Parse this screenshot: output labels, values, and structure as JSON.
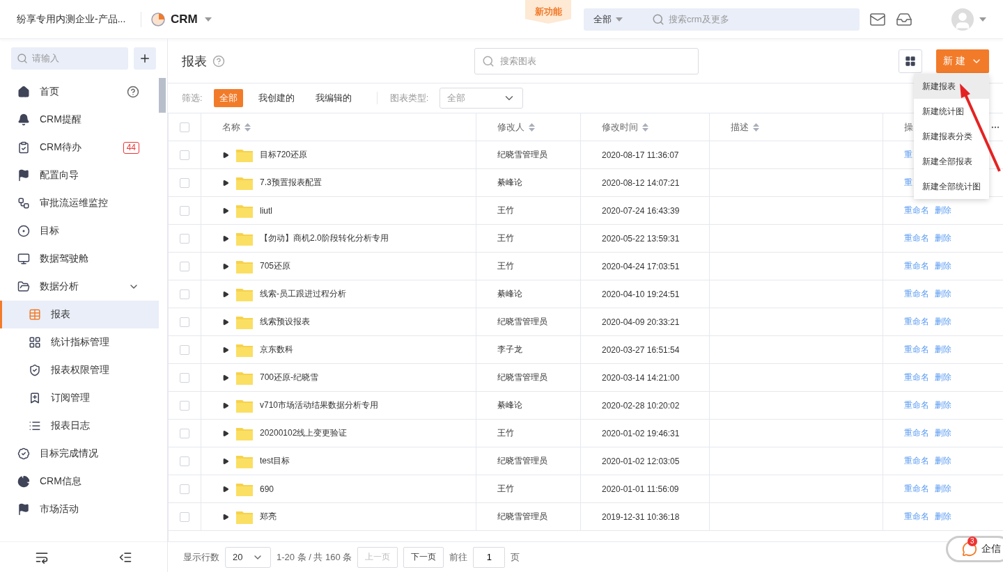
{
  "header": {
    "org": "纷享专用内测企业-产品...",
    "app": "CRM",
    "new_feature": "新功能",
    "search_scope": "全部",
    "search_placeholder": "搜索crm及更多"
  },
  "sidebar": {
    "search_placeholder": "请输入",
    "items": [
      {
        "kind": "home",
        "label": "首页",
        "help": true
      },
      {
        "kind": "bell",
        "label": "CRM提醒"
      },
      {
        "kind": "clipboard",
        "label": "CRM待办",
        "badge": "44"
      },
      {
        "kind": "flag",
        "label": "配置向导"
      },
      {
        "kind": "flow",
        "label": "审批流运维监控"
      },
      {
        "kind": "target",
        "label": "目标"
      },
      {
        "kind": "monitor",
        "label": "数据驾驶舱"
      },
      {
        "kind": "folder",
        "label": "数据分析",
        "expanded": true,
        "children": [
          {
            "kind": "table",
            "label": "报表",
            "selected": true
          },
          {
            "kind": "grid",
            "label": "统计指标管理",
            "selected": false
          },
          {
            "kind": "shield",
            "label": "报表权限管理",
            "selected": false
          },
          {
            "kind": "bookmark",
            "label": "订阅管理",
            "selected": false
          },
          {
            "kind": "list",
            "label": "报表日志",
            "selected": false
          }
        ]
      },
      {
        "kind": "badge",
        "label": "目标完成情况"
      },
      {
        "kind": "pie",
        "label": "CRM信息"
      },
      {
        "kind": "flag",
        "label": "市场活动"
      }
    ]
  },
  "main": {
    "title": "报表",
    "search_placeholder": "搜索图表",
    "new_button": "新 建",
    "new_menu": [
      {
        "label": "新建报表",
        "selected": true
      },
      {
        "label": "新建统计图",
        "selected": false
      },
      {
        "label": "新建报表分类",
        "selected": false
      },
      {
        "label": "新建全部报表",
        "selected": false
      },
      {
        "label": "新建全部统计图",
        "selected": false
      }
    ],
    "filter": {
      "label": "筛选:",
      "options": [
        {
          "label": "全部",
          "selected": true
        },
        {
          "label": "我创建的",
          "selected": false
        },
        {
          "label": "我编辑的",
          "selected": false
        }
      ],
      "type_label": "图表类型:",
      "type_value": "全部"
    },
    "table": {
      "select_all": {
        "checked": false
      },
      "columns": [
        {
          "label": "名称",
          "sortable": true
        },
        {
          "label": "修改人",
          "sortable": true
        },
        {
          "label": "修改时间",
          "sortable": true
        },
        {
          "label": "描述",
          "sortable": true
        },
        {
          "label": "操"
        }
      ],
      "rows": [
        {
          "name": "目标720还原",
          "modifier": "纪晓雪管理员",
          "time": "2020-08-17 11:36:07",
          "actions": [
            "重"
          ],
          "checked": false
        },
        {
          "name": "7.3预置报表配置",
          "modifier": "綦峰论",
          "time": "2020-08-12 14:07:21",
          "actions": [
            "重"
          ],
          "checked": false
        },
        {
          "name": "liutl",
          "modifier": "王竹",
          "time": "2020-07-24 16:43:39",
          "actions": [
            "重命名",
            "删除"
          ],
          "checked": false
        },
        {
          "name": "【勿动】商机2.0阶段转化分析专用",
          "modifier": "王竹",
          "time": "2020-05-22 13:59:31",
          "actions": [
            "重命名",
            "删除"
          ],
          "checked": false
        },
        {
          "name": "705还原",
          "modifier": "王竹",
          "time": "2020-04-24 17:03:51",
          "actions": [
            "重命名",
            "删除"
          ],
          "checked": false
        },
        {
          "name": "线索-员工跟进过程分析",
          "modifier": "綦峰论",
          "time": "2020-04-10 19:24:51",
          "actions": [
            "重命名",
            "删除"
          ],
          "checked": false
        },
        {
          "name": "线索预设报表",
          "modifier": "纪晓雪管理员",
          "time": "2020-04-09 20:33:21",
          "actions": [
            "重命名",
            "删除"
          ],
          "checked": false
        },
        {
          "name": "京东数科",
          "modifier": "李子龙",
          "time": "2020-03-27 16:51:54",
          "actions": [
            "重命名",
            "删除"
          ],
          "checked": false
        },
        {
          "name": "700还原-纪晓雪",
          "modifier": "纪晓雪管理员",
          "time": "2020-03-14 14:21:00",
          "actions": [
            "重命名",
            "删除"
          ],
          "checked": false
        },
        {
          "name": "v710市场活动结果数据分析专用",
          "modifier": "綦峰论",
          "time": "2020-02-28 10:20:02",
          "actions": [
            "重命名",
            "删除"
          ],
          "checked": false
        },
        {
          "name": "20200102线上变更验证",
          "modifier": "王竹",
          "time": "2020-01-02 19:46:31",
          "actions": [
            "重命名",
            "删除"
          ],
          "checked": false
        },
        {
          "name": "test目标",
          "modifier": "纪晓雪管理员",
          "time": "2020-01-02 12:03:05",
          "actions": [
            "重命名",
            "删除"
          ],
          "checked": false
        },
        {
          "name": "690",
          "modifier": "王竹",
          "time": "2020-01-01 11:56:09",
          "actions": [
            "重命名",
            "删除"
          ],
          "checked": false
        },
        {
          "name": "郑亮",
          "modifier": "纪晓雪管理员",
          "time": "2019-12-31 10:36:18",
          "actions": [
            "重命名",
            "删除"
          ],
          "checked": false
        }
      ]
    },
    "pager": {
      "rows_label": "显示行数",
      "page_size": "20",
      "range": "1-20 条 / 共 160 条",
      "prev": "上一页",
      "next": "下一页",
      "goto": "前往",
      "page": "1",
      "page_unit": "页"
    }
  },
  "chat": {
    "label": "企信",
    "badge": "3"
  }
}
